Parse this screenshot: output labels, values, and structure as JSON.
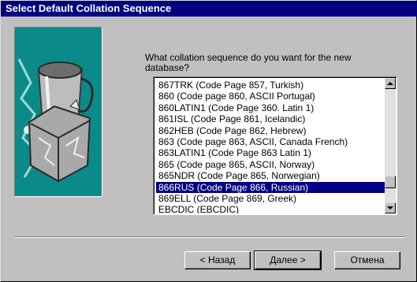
{
  "dialog": {
    "title": "Select Default Collation Sequence"
  },
  "prompt": "What collation sequence do you want for the new database?",
  "collation_list": {
    "items": [
      "867TRK (Code Page 857, Turkish)",
      "860 (Code page 860, ASCII Portugal)",
      "860LATIN1 (Code Page 360. Latin 1)",
      "861ISL (Code Page 861, Icelandic)",
      "862HEB (Code Page 862, Hebrew)",
      "863 (Code page 863, ASCII, Canada French)",
      "863LATIN1 (Code Page 863 Latin 1)",
      "865 (Code page 865, ASCII, Norway)",
      "865NDR (Code Page 865, Norwegian)",
      "866RUS (Code Page 866, Russian)",
      "869ELL (Code Page 869, Greek)",
      "EBCDIC (EBCDIC)"
    ],
    "selected_index": 9
  },
  "buttons": {
    "back": "< Назад",
    "next": "Далее >",
    "cancel": "Отмена"
  },
  "colors": {
    "titlebar": "#000080",
    "selection": "#000080",
    "art_background": "#0b8a8a"
  },
  "icons": [
    "scroll-up-arrow-icon",
    "scroll-down-arrow-icon"
  ]
}
